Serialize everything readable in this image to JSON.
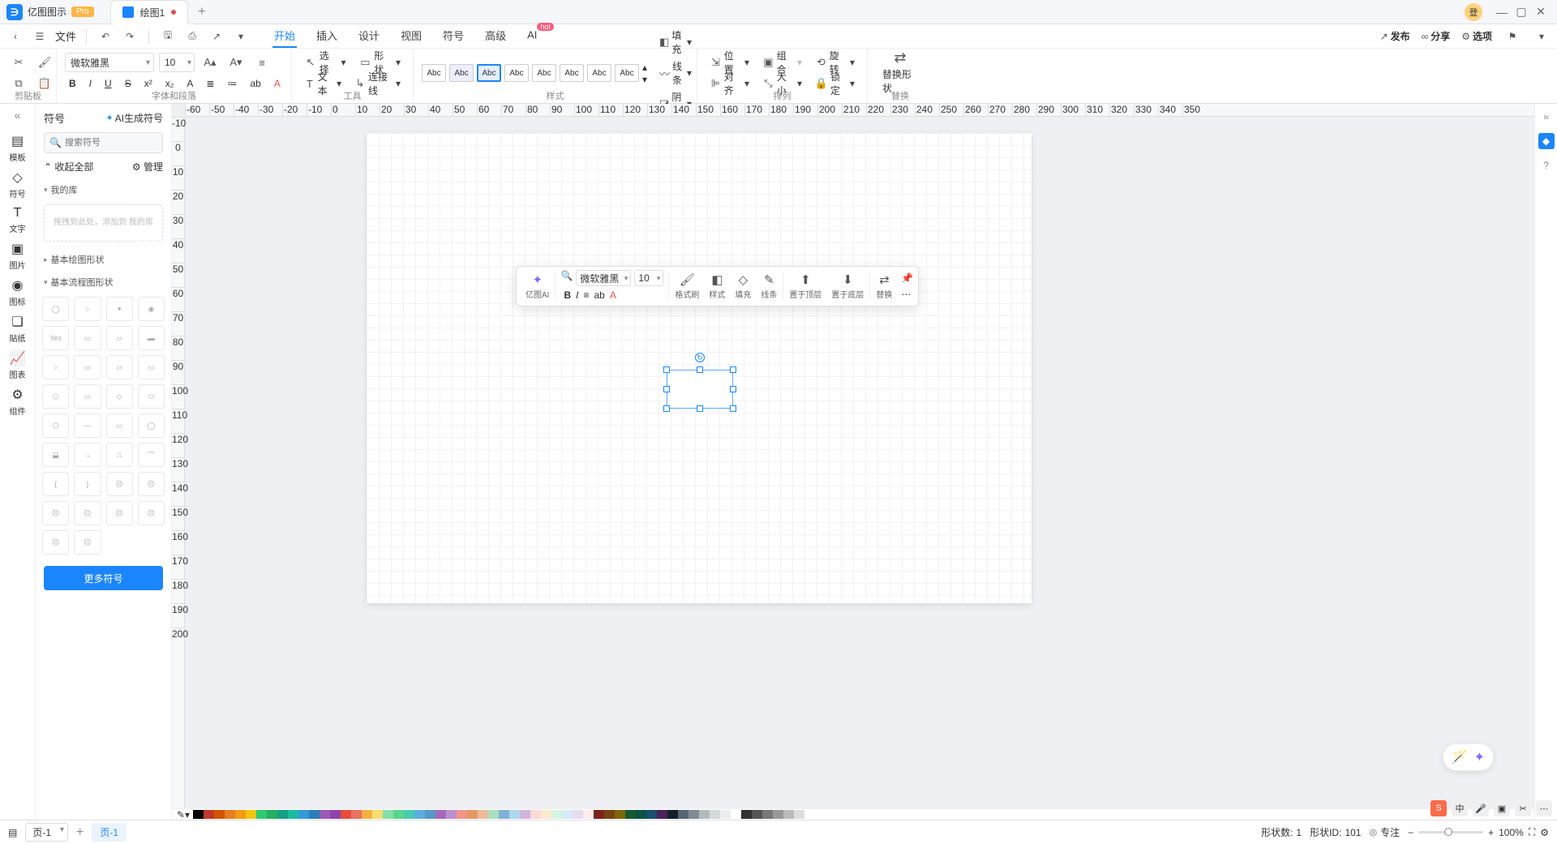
{
  "app": {
    "name": "亿图图示",
    "pro": "Pro",
    "doc": "绘图1",
    "avatar": "登"
  },
  "win": {
    "min": "—",
    "max": "▢",
    "close": "✕"
  },
  "toolbar": {
    "back": "‹",
    "fwd": "›",
    "menu": "☰",
    "file": "文件",
    "undo": "↶",
    "redo": "↷",
    "save": "🖫",
    "print": "⎙",
    "export": "↗"
  },
  "menus": [
    "开始",
    "插入",
    "设计",
    "视图",
    "符号",
    "高级",
    "AI"
  ],
  "menu_hot": "hot",
  "top_right": {
    "publish": "发布",
    "share": "分享",
    "options": "选项"
  },
  "ribbon": {
    "clipboard": {
      "label": "剪贴板",
      "cut": "✂",
      "brush": "🖌",
      "copy": "⧉",
      "paste": "📋"
    },
    "font": {
      "label": "字体和段落",
      "name": "微软雅黑",
      "size": "10",
      "grow": "A▴",
      "shrink": "A▾",
      "align": "≡",
      "bold": "B",
      "italic": "I",
      "underline": "U",
      "strike": "S",
      "sup": "x²",
      "sub": "x₂",
      "textcolor": "A",
      "linespace": "≣",
      "bullets": "≔",
      "case": "ab",
      "color": "A"
    },
    "tools": {
      "label": "工具",
      "select": "选择",
      "shape": "形状",
      "text": "文本",
      "connector": "连接线"
    },
    "styles": {
      "label": "样式",
      "abc": "Abc",
      "fill": "填充",
      "line": "线条",
      "shadow": "阴影"
    },
    "arrange": {
      "label": "排列",
      "position": "位置",
      "group": "组合",
      "rotate": "旋转",
      "align": "对齐",
      "size": "大小",
      "lock": "锁定"
    },
    "replace": {
      "label": "替换",
      "swap": "替换形状"
    }
  },
  "leftbar": {
    "items": [
      {
        "icon": "▤",
        "label": "模板"
      },
      {
        "icon": "◇",
        "label": "符号"
      },
      {
        "icon": "T",
        "label": "文字"
      },
      {
        "icon": "▣",
        "label": "图片"
      },
      {
        "icon": "◉",
        "label": "图标"
      },
      {
        "icon": "❏",
        "label": "贴纸"
      },
      {
        "icon": "📈",
        "label": "图表"
      },
      {
        "icon": "⚙",
        "label": "组件"
      }
    ]
  },
  "sym": {
    "title": "符号",
    "ai": "AI生成符号",
    "search_ph": "搜索符号",
    "collapse": "收起全部",
    "manage": "管理",
    "mylib": "我的库",
    "drop": "拖拽到此处，添加到\n我的库",
    "cat1": "基本绘图形状",
    "cat2": "基本流程图形状",
    "more": "更多符号"
  },
  "float": {
    "ai": "亿图AI",
    "font": "微软雅黑",
    "size": "10",
    "format": "格式刷",
    "style": "样式",
    "fill": "填充",
    "line": "线条",
    "top": "置于顶层",
    "bottom": "置于底层",
    "swap": "替换"
  },
  "ruler_h": [
    "-60",
    "-50",
    "-40",
    "-30",
    "-20",
    "-10",
    "0",
    "10",
    "20",
    "30",
    "40",
    "50",
    "60",
    "70",
    "80",
    "90",
    "100",
    "110",
    "120",
    "130",
    "140",
    "150",
    "160",
    "170",
    "180",
    "190",
    "200",
    "210",
    "220",
    "230",
    "240",
    "250",
    "260",
    "270",
    "280",
    "290",
    "300",
    "310",
    "320",
    "330",
    "340",
    "350"
  ],
  "ruler_v": [
    "-10",
    "0",
    "10",
    "20",
    "30",
    "40",
    "50",
    "60",
    "70",
    "80",
    "90",
    "100",
    "110",
    "120",
    "130",
    "140",
    "150",
    "160",
    "170",
    "180",
    "190",
    "200"
  ],
  "colors": [
    "#000",
    "#c0392b",
    "#d35400",
    "#e67e22",
    "#f39c12",
    "#f1c40f",
    "#2ecc71",
    "#27ae60",
    "#16a085",
    "#1abc9c",
    "#3498db",
    "#2980b9",
    "#9b59b6",
    "#8e44ad",
    "#e74c3c",
    "#ec7063",
    "#f5b041",
    "#f7dc6f",
    "#82e0aa",
    "#58d68d",
    "#48c9b0",
    "#5dade2",
    "#5499c7",
    "#a569bd",
    "#bb8fce",
    "#f1948a",
    "#e59866",
    "#edbb99",
    "#a9dfbf",
    "#7fb3d5",
    "#aed6f1",
    "#d2b4de",
    "#fadbd8",
    "#fdebd0",
    "#d5f5e3",
    "#d6eaf8",
    "#e8daef",
    "#fdedec",
    "#7b241c",
    "#784212",
    "#7d6608",
    "#145a32",
    "#0b5345",
    "#1b4f72",
    "#4a235a",
    "#17202a",
    "#566573",
    "#808b96",
    "#b2babb",
    "#d5d8dc",
    "#eaeded",
    "#fff",
    "#333",
    "#555",
    "#777",
    "#999",
    "#bbb",
    "#ddd"
  ],
  "status": {
    "page_sel": "页-1",
    "add": "+",
    "page_tab": "页-1",
    "shapes_l": "形状数:",
    "shapes_v": "1",
    "id_l": "形状ID:",
    "id_v": "101",
    "focus": "专注",
    "zoom": "100%",
    "fit": "⛶",
    "gear": "⚙"
  }
}
